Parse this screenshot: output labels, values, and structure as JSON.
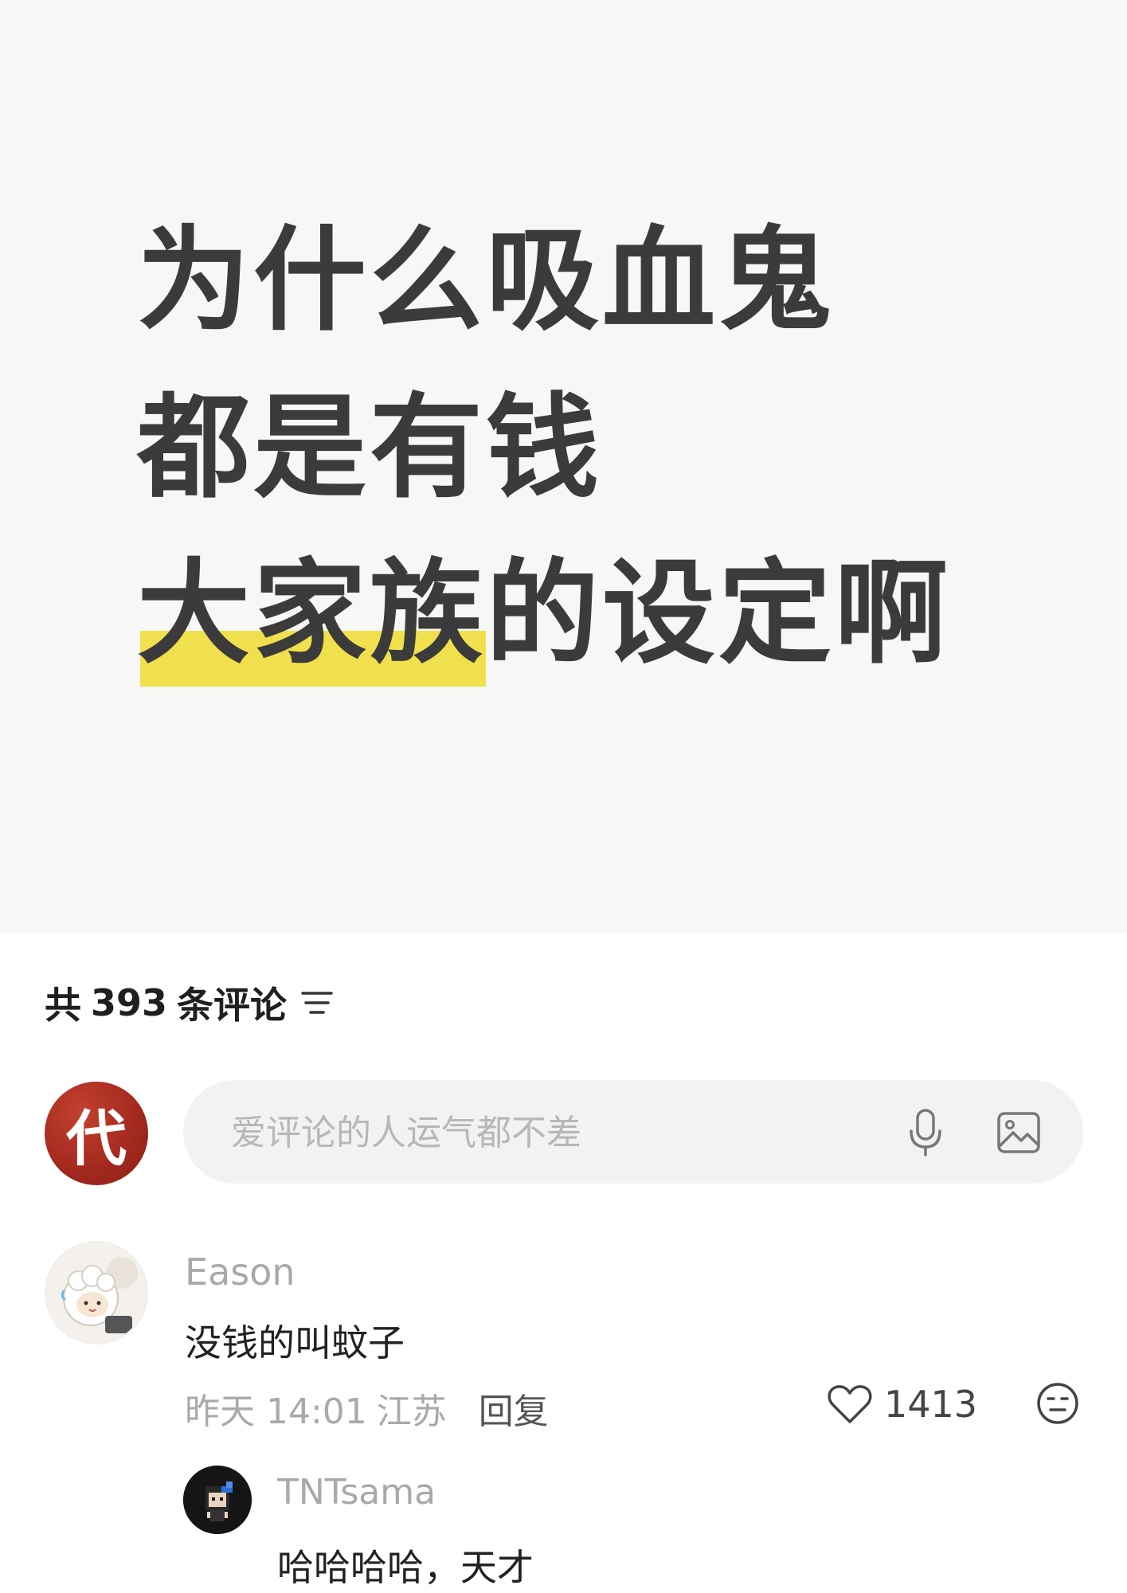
{
  "post": {
    "line1": "为什么吸血鬼",
    "line2": "都是有钱",
    "line3_highlight": "大家族",
    "line3_rest": "的设定啊",
    "highlight_color": "#f1e04d"
  },
  "comments_header": {
    "prefix": "共",
    "count": "393",
    "suffix": "条评论",
    "sort_icon": "filter-lines-icon"
  },
  "composer": {
    "avatar_char": "代",
    "placeholder": "爱评论的人运气都不差",
    "mic_icon": "microphone-icon",
    "image_icon": "image-icon"
  },
  "comment": {
    "author": "Eason",
    "text": "没钱的叫蚊子",
    "time": "昨天 14:01",
    "location": "江苏",
    "reply_label": "回复",
    "likes": "1413"
  },
  "reply": {
    "author": "TNTsama",
    "text": "哈哈哈哈，天才"
  }
}
